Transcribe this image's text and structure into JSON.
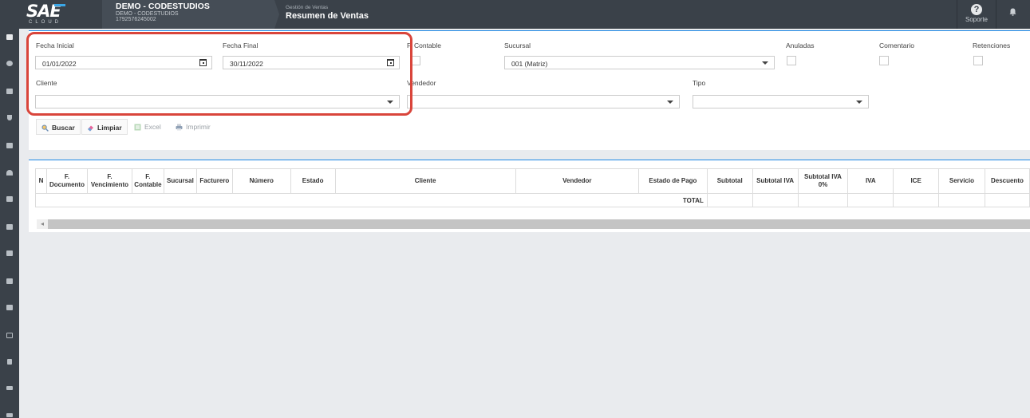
{
  "header": {
    "logo_text": "SAE",
    "logo_sub": "CLOUD",
    "company_name": "DEMO - CODESTUDIOS",
    "company_sub": "DEMO - CODESTUDIOS",
    "company_ruc": "1792576245002",
    "breadcrumb_small": "Gestión de Ventas",
    "page_title": "Resumen de Ventas",
    "support_label": "Soporte"
  },
  "filters": {
    "fecha_inicial_label": "Fecha Inicial",
    "fecha_inicial_value": "01/01/2022",
    "fecha_final_label": "Fecha Final",
    "fecha_final_value": "30/11/2022",
    "f_contable_label": "F. Contable",
    "sucursal_label": "Sucursal",
    "sucursal_value": "001 (Matriz)",
    "anuladas_label": "Anuladas",
    "comentario_label": "Comentario",
    "retenciones_label": "Retenciones",
    "cliente_label": "Cliente",
    "cliente_value": "",
    "vendedor_label": "Vendedor",
    "vendedor_value": "",
    "tipo_label": "Tipo",
    "tipo_value": ""
  },
  "actions": {
    "buscar": "Buscar",
    "limpiar": "Limpiar",
    "excel": "Excel",
    "imprimir": "Imprimir"
  },
  "table": {
    "columns": [
      "N",
      "F. Documento",
      "F. Vencimiento",
      "F. Contable",
      "Sucursal",
      "Facturero",
      "Número",
      "Estado",
      "Cliente",
      "Vendedor",
      "Estado de Pago",
      "Subtotal",
      "Subtotal IVA",
      "Subtotal IVA 0%",
      "IVA",
      "ICE",
      "Servicio",
      "Descuento"
    ],
    "total_label": "TOTAL"
  },
  "colors": {
    "topbar": "#3a4149",
    "accent": "#1e88e5",
    "highlight": "#d9453b"
  }
}
